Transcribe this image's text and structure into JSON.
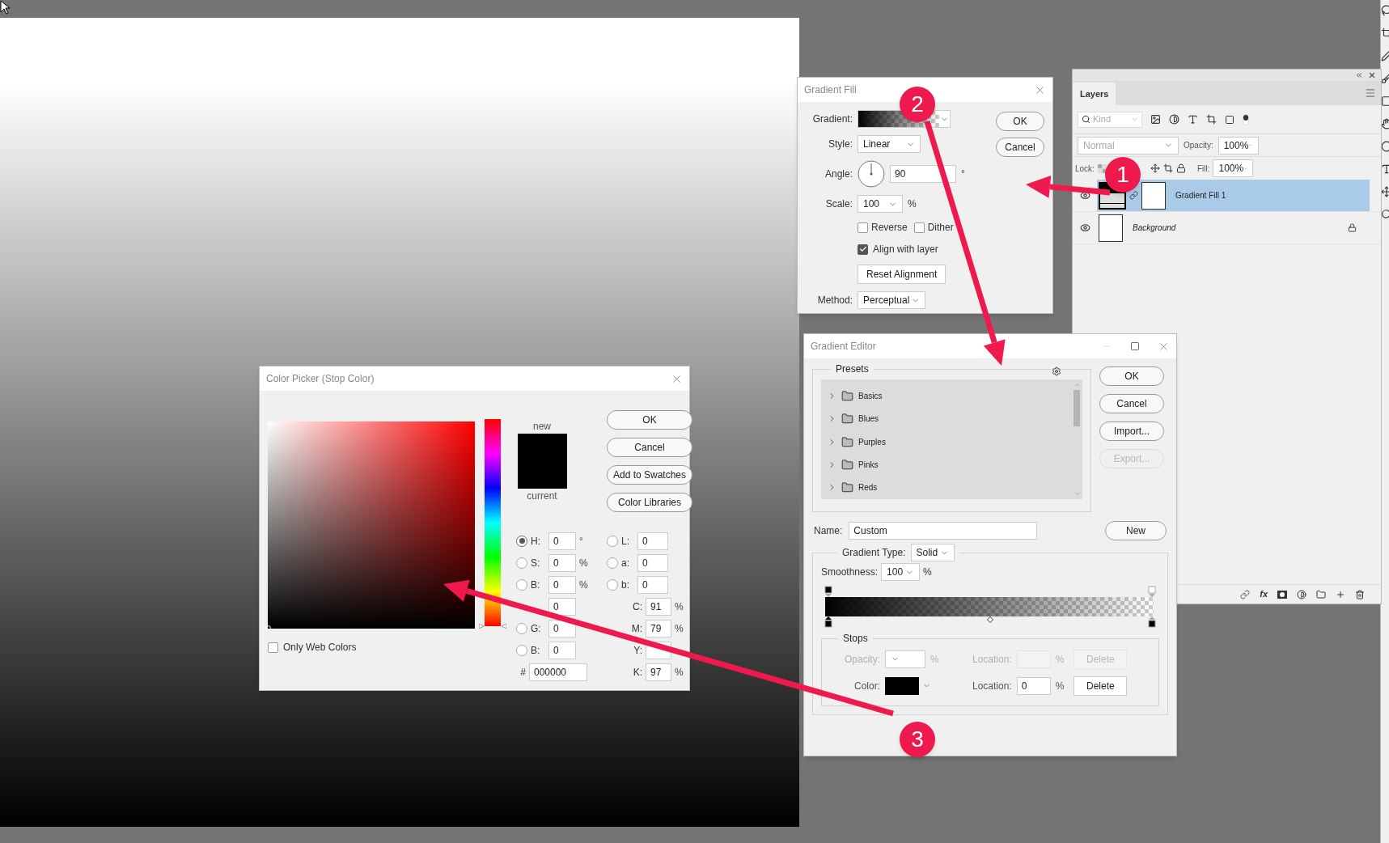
{
  "gradient_fill": {
    "title": "Gradient Fill",
    "gradient_label": "Gradient:",
    "style_label": "Style:",
    "style": "Linear",
    "angle_label": "Angle:",
    "angle": "90",
    "degree": "°",
    "scale_label": "Scale:",
    "scale": "100",
    "percent": "%",
    "options": [
      {
        "label": "Reverse",
        "checked": false
      },
      {
        "label": "Dither",
        "checked": false
      },
      {
        "label": "Align with layer",
        "checked": true
      }
    ],
    "reset_button": "Reset Alignment",
    "method_label": "Method:",
    "method": "Perceptual",
    "buttons": [
      "OK",
      "Cancel"
    ]
  },
  "layers": {
    "tab": "Layers",
    "filter_placeholder": "Kind",
    "blend_mode": "Normal",
    "opacity_label": "Opacity:",
    "opacity": "100%",
    "lock_label": "Lock:",
    "fill_label": "Fill:",
    "fill": "100%",
    "fx_label": "fx",
    "items": [
      {
        "name": "Gradient Fill 1",
        "kind": "fill",
        "selected": true
      },
      {
        "name": "Background",
        "kind": "background",
        "selected": false
      }
    ]
  },
  "gradient_editor": {
    "title": "Gradient Editor",
    "presets_label": "Presets",
    "presets": [
      {
        "name": "Basics",
        "expanded": false
      },
      {
        "name": "Blues",
        "expanded": false
      },
      {
        "name": "Purples",
        "expanded": false
      },
      {
        "name": "Pinks",
        "expanded": false
      },
      {
        "name": "Reds",
        "expanded": false
      }
    ],
    "buttons": [
      {
        "label": "OK",
        "disabled": false
      },
      {
        "label": "Cancel",
        "disabled": false
      },
      {
        "label": "Import...",
        "disabled": false
      },
      {
        "label": "Export...",
        "disabled": true
      }
    ],
    "name_label": "Name:",
    "name": "Custom",
    "new_button": "New",
    "type_label": "Gradient Type:",
    "type": "Solid",
    "smoothness_label": "Smoothness:",
    "smoothness": "100",
    "smoothness_unit": "%",
    "stops_label": "Stops",
    "stop_rows": [
      {
        "kind": "opacity",
        "label": "Opacity:",
        "unit": "%",
        "location_label": "Location:",
        "location_unit": "%",
        "delete": "Delete",
        "disabled": true
      },
      {
        "kind": "color",
        "label": "Color:",
        "location_label": "Location:",
        "location": "0",
        "location_unit": "%",
        "delete": "Delete",
        "disabled": false
      }
    ]
  },
  "color_picker": {
    "title": "Color Picker (Stop Color)",
    "new_label": "new",
    "current_label": "current",
    "buttons": [
      "OK",
      "Cancel",
      "Add to Swatches",
      "Color Libraries"
    ],
    "web_colors": {
      "label": "Only Web Colors",
      "checked": false
    },
    "left_fields": [
      {
        "label": "H:",
        "value": "0",
        "unit": "°",
        "selected": true
      },
      {
        "label": "S:",
        "value": "0",
        "unit": "%",
        "selected": false
      },
      {
        "label": "B:",
        "value": "0",
        "unit": "%",
        "selected": false
      },
      {
        "value": "0"
      },
      {
        "label": "G:",
        "value": "0",
        "selected": false
      },
      {
        "label": "B:",
        "value": "0",
        "selected": false
      }
    ],
    "lab_fields": [
      {
        "label": "L:",
        "value": "0",
        "selected": false
      },
      {
        "label": "a:",
        "value": "0",
        "selected": false
      },
      {
        "label": "b:",
        "value": "0",
        "selected": false
      }
    ],
    "cmyk_fields": [
      {
        "label": "C:",
        "value": "91",
        "unit": "%"
      },
      {
        "label": "M:",
        "value": "79",
        "unit": "%"
      },
      {
        "label": "Y:"
      },
      {
        "label": "K:",
        "value": "97",
        "unit": "%"
      }
    ],
    "hex_label": "#",
    "hex": "000000",
    "hue": {
      "level": 0
    }
  },
  "annotations": [
    {
      "label": "1"
    },
    {
      "label": "2"
    },
    {
      "label": "3"
    }
  ]
}
